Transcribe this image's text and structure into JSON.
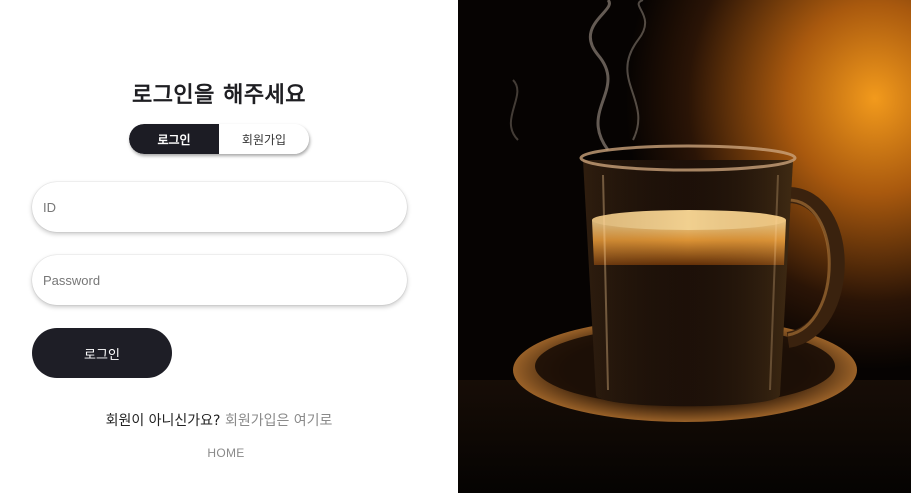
{
  "login": {
    "title": "로그인을 해주세요",
    "tabs": [
      {
        "label": "로그인",
        "active": true
      },
      {
        "label": "회원가입",
        "active": false
      }
    ],
    "id_field": {
      "placeholder": "ID",
      "value": ""
    },
    "password_field": {
      "placeholder": "Password",
      "value": ""
    },
    "submit_label": "로그인",
    "signup_prompt": "회원이 아니신가요?",
    "signup_link": "회원가입은 여기로",
    "home_link": "HOME"
  },
  "hero_image": {
    "subject": "coffee-cup-photo"
  },
  "colors": {
    "primary_dark": "#1e1e26",
    "link_gray": "#8a8a8a",
    "background": "#ffffff"
  }
}
